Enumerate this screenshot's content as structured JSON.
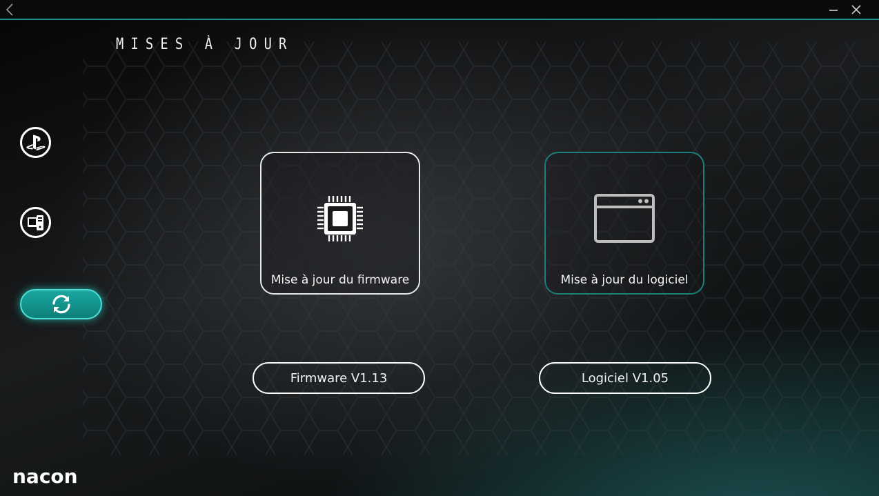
{
  "window": {
    "back_icon": "chevron-left-icon",
    "minimize_icon": "minimize-icon",
    "close_icon": "close-icon"
  },
  "header": {
    "title": "MISES À JOUR"
  },
  "sidebar": {
    "items": [
      {
        "icon": "playstation-icon",
        "active": false
      },
      {
        "icon": "pc-icon",
        "active": false
      },
      {
        "icon": "refresh-icon",
        "active": true
      }
    ]
  },
  "cards": {
    "firmware": {
      "label": "Mise à jour du firmware",
      "icon": "chip-icon"
    },
    "software": {
      "label": "Mise à jour du logiciel",
      "icon": "app-window-icon"
    }
  },
  "versions": {
    "firmware": "Firmware V1.13",
    "software": "Logiciel V1.05"
  },
  "brand": {
    "logo": "nacon",
    "accent": "#1aa7a0",
    "accent_border": "#1c7f7a"
  }
}
